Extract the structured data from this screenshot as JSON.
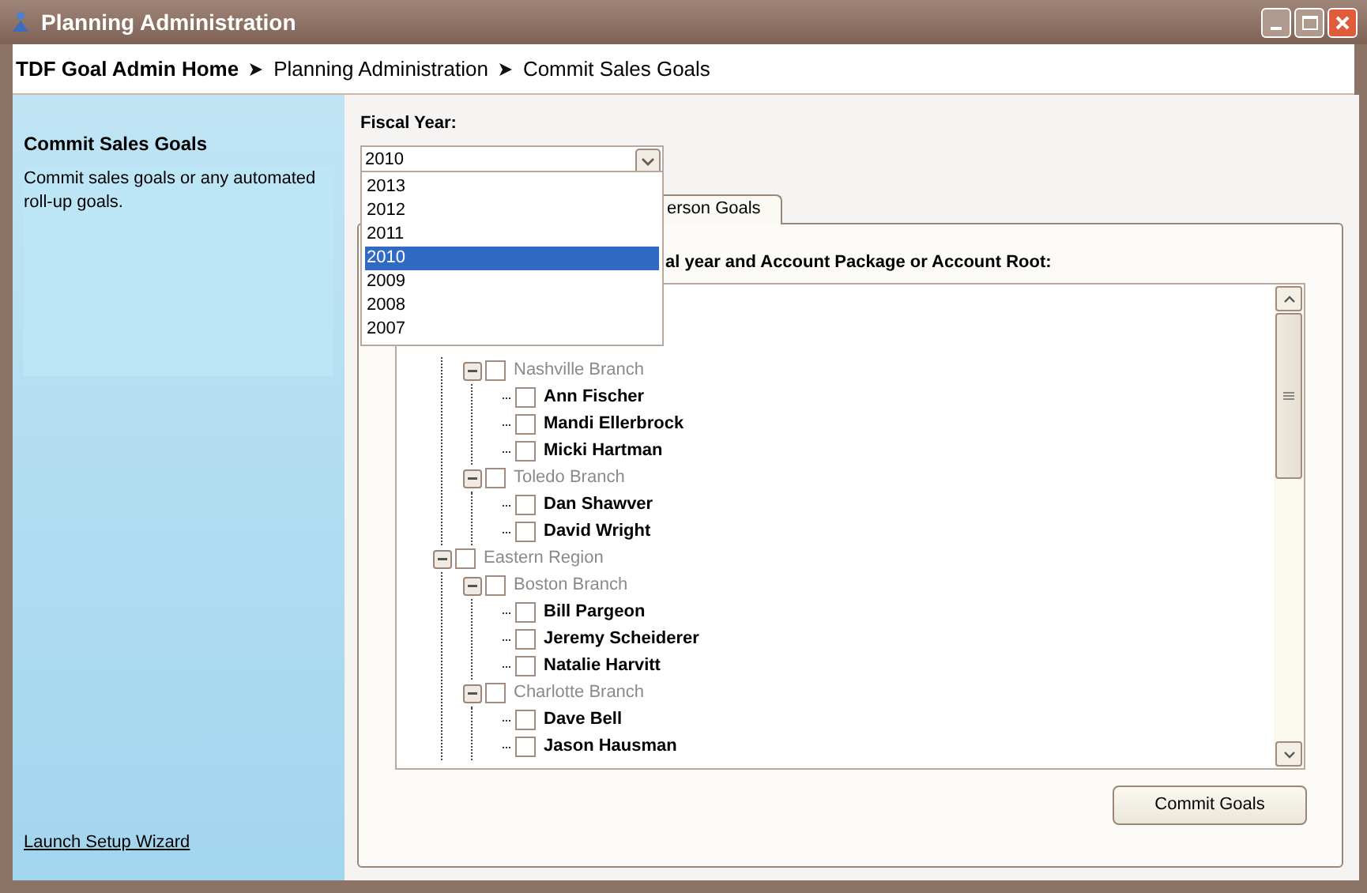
{
  "window": {
    "title": "Planning Administration"
  },
  "breadcrumb": [
    {
      "label": "TDF Goal Admin Home"
    },
    {
      "label": "Planning Administration"
    },
    {
      "label": "Commit Sales Goals"
    }
  ],
  "sidebar": {
    "title": "Commit Sales Goals",
    "description": "Commit sales goals or any automated roll-up goals.",
    "link": "Launch Setup Wizard"
  },
  "fiscal_year": {
    "label": "Fiscal Year:",
    "value": "2010",
    "expanded": true,
    "options": [
      {
        "label": "2013",
        "selected": false
      },
      {
        "label": "2012",
        "selected": false
      },
      {
        "label": "2011",
        "selected": false
      },
      {
        "label": "2010",
        "selected": true
      },
      {
        "label": "2009",
        "selected": false
      },
      {
        "label": "2008",
        "selected": false
      },
      {
        "label": "2007",
        "selected": false
      }
    ]
  },
  "tab": {
    "label": "erson Goals"
  },
  "instruction": "al year and Account Package or Account Root:",
  "tree": [
    {
      "children": [
        {
          "label": "Nashville Branch",
          "kind": "group",
          "checked": false,
          "expanded": true,
          "children": [
            {
              "label": "Ann Fischer",
              "kind": "person",
              "checked": false
            },
            {
              "label": "Mandi Ellerbrock",
              "kind": "person",
              "checked": false
            },
            {
              "label": "Micki Hartman",
              "kind": "person",
              "checked": false
            }
          ]
        },
        {
          "label": "Toledo Branch",
          "kind": "group",
          "checked": false,
          "expanded": true,
          "children": [
            {
              "label": "Dan Shawver",
              "kind": "person",
              "checked": false
            },
            {
              "label": "David Wright",
              "kind": "person",
              "checked": false
            }
          ]
        }
      ]
    },
    {
      "label": "Eastern Region",
      "kind": "group",
      "checked": false,
      "expanded": true,
      "children": [
        {
          "label": "Boston Branch",
          "kind": "group",
          "checked": false,
          "expanded": true,
          "children": [
            {
              "label": "Bill Pargeon",
              "kind": "person",
              "checked": false
            },
            {
              "label": "Jeremy Scheiderer",
              "kind": "person",
              "checked": false
            },
            {
              "label": "Natalie Harvitt",
              "kind": "person",
              "checked": false
            }
          ]
        },
        {
          "label": "Charlotte Branch",
          "kind": "group",
          "checked": false,
          "expanded": true,
          "children": [
            {
              "label": "Dave Bell",
              "kind": "person",
              "checked": false
            },
            {
              "label": "Jason Hausman",
              "kind": "person",
              "checked": false
            }
          ]
        }
      ]
    }
  ],
  "commit_button": "Commit Goals"
}
